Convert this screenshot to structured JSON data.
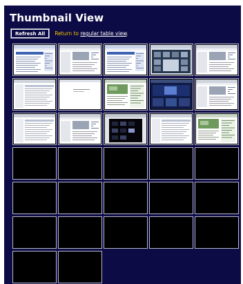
{
  "title": "Thumbnail View",
  "toolbar": {
    "refresh_label": "Refresh All",
    "return_prefix": "Return to ",
    "return_link": "regular table view",
    "return_suffix": "."
  },
  "colors": {
    "background": "#0d0b45",
    "title": "#ffffff",
    "return_text": "#f2c400",
    "cell_border": "#b8b8cc",
    "empty_cell": "#000000"
  },
  "thumbnails": [
    {
      "style": "web-blue"
    },
    {
      "style": "web-grey"
    },
    {
      "style": "web-blue"
    },
    {
      "style": "web-dark"
    },
    {
      "style": "web-grey"
    },
    {
      "style": "table-grey"
    },
    {
      "style": "blank-white"
    },
    {
      "style": "web-green"
    },
    {
      "style": "web-darkblue"
    },
    {
      "style": "web-grey"
    },
    {
      "style": "table-grey"
    },
    {
      "style": "web-grey"
    },
    {
      "style": "black-grid"
    },
    {
      "style": "table-grey"
    },
    {
      "style": "web-green"
    },
    {
      "style": "empty"
    },
    {
      "style": "empty"
    },
    {
      "style": "empty"
    },
    {
      "style": "empty"
    },
    {
      "style": "empty"
    },
    {
      "style": "empty"
    },
    {
      "style": "empty"
    },
    {
      "style": "empty"
    },
    {
      "style": "empty"
    },
    {
      "style": "empty"
    },
    {
      "style": "empty"
    },
    {
      "style": "empty"
    },
    {
      "style": "empty"
    },
    {
      "style": "empty"
    },
    {
      "style": "empty"
    },
    {
      "style": "empty"
    },
    {
      "style": "empty"
    }
  ]
}
